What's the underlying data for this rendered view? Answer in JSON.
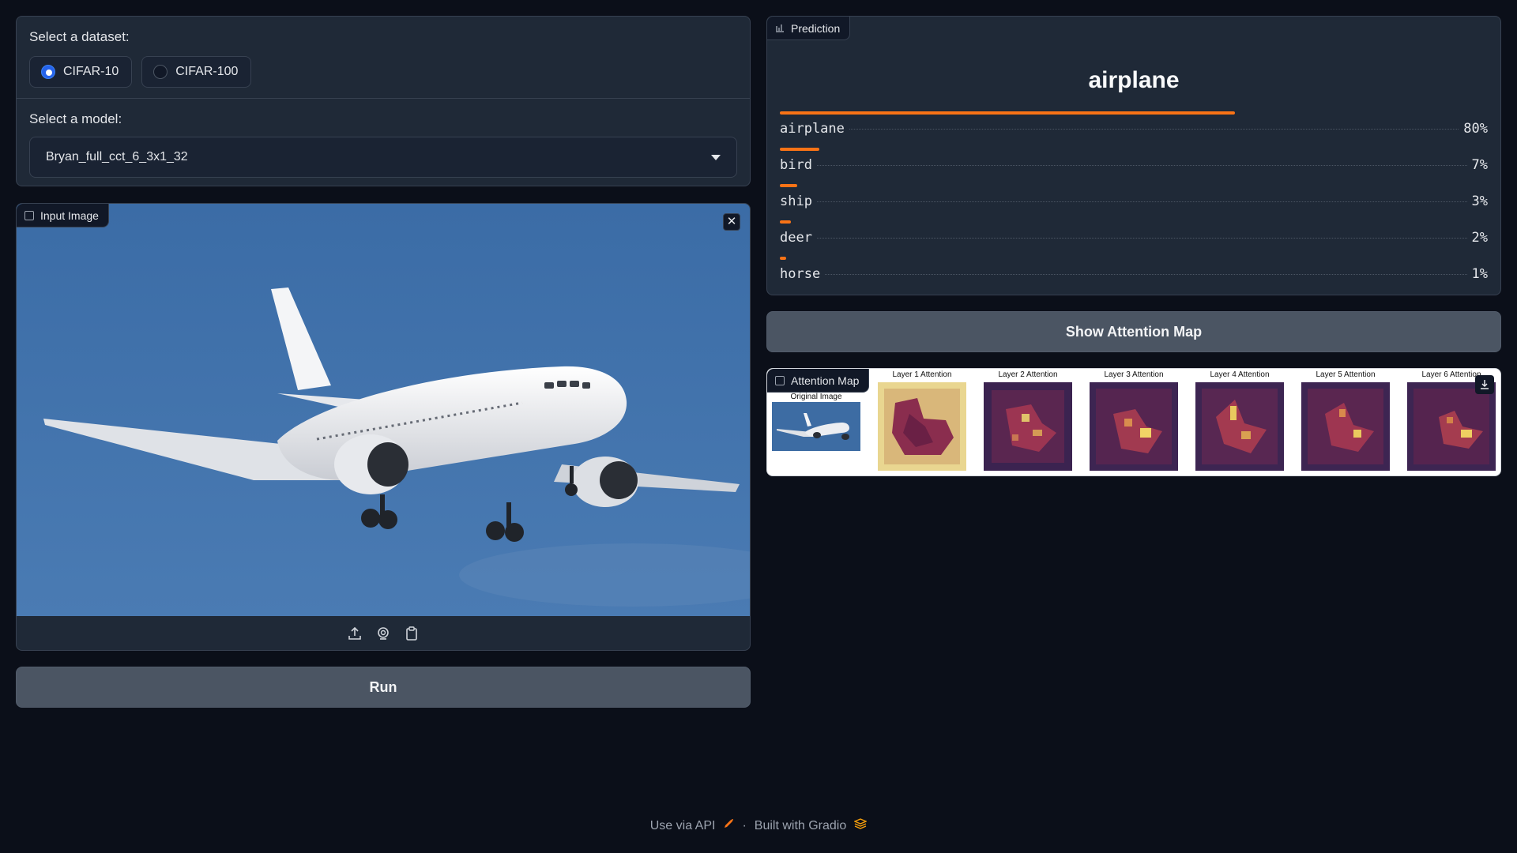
{
  "dataset": {
    "label": "Select a dataset:",
    "options": [
      {
        "label": "CIFAR-10",
        "selected": true
      },
      {
        "label": "CIFAR-100",
        "selected": false
      }
    ]
  },
  "model": {
    "label": "Select a model:",
    "value": "Bryan_full_cct_6_3x1_32"
  },
  "input_image": {
    "tag": "Input Image",
    "close_symbol": "✕"
  },
  "run_button": "Run",
  "prediction": {
    "tag": "Prediction",
    "top_label": "airplane",
    "confidences": [
      {
        "label": "airplane",
        "percent_text": "80%",
        "value": 0.8
      },
      {
        "label": "bird",
        "percent_text": "7%",
        "value": 0.07
      },
      {
        "label": "ship",
        "percent_text": "3%",
        "value": 0.03
      },
      {
        "label": "deer",
        "percent_text": "2%",
        "value": 0.02
      },
      {
        "label": "horse",
        "percent_text": "1%",
        "value": 0.01
      }
    ],
    "bar_color": "#f97316"
  },
  "attention_button": "Show Attention Map",
  "attention_map": {
    "tag": "Attention Map",
    "captions": [
      "Original Image",
      "Layer 1 Attention",
      "Layer 2 Attention",
      "Layer 3 Attention",
      "Layer 4 Attention",
      "Layer 5 Attention",
      "Layer 6 Attention"
    ]
  },
  "footer": {
    "api": "Use via API",
    "separator": "·",
    "built": "Built with Gradio"
  },
  "colors": {
    "background": "#0b0f19",
    "panel": "#1f2937",
    "accent": "#2563eb",
    "sky": "#3f6fa3"
  }
}
